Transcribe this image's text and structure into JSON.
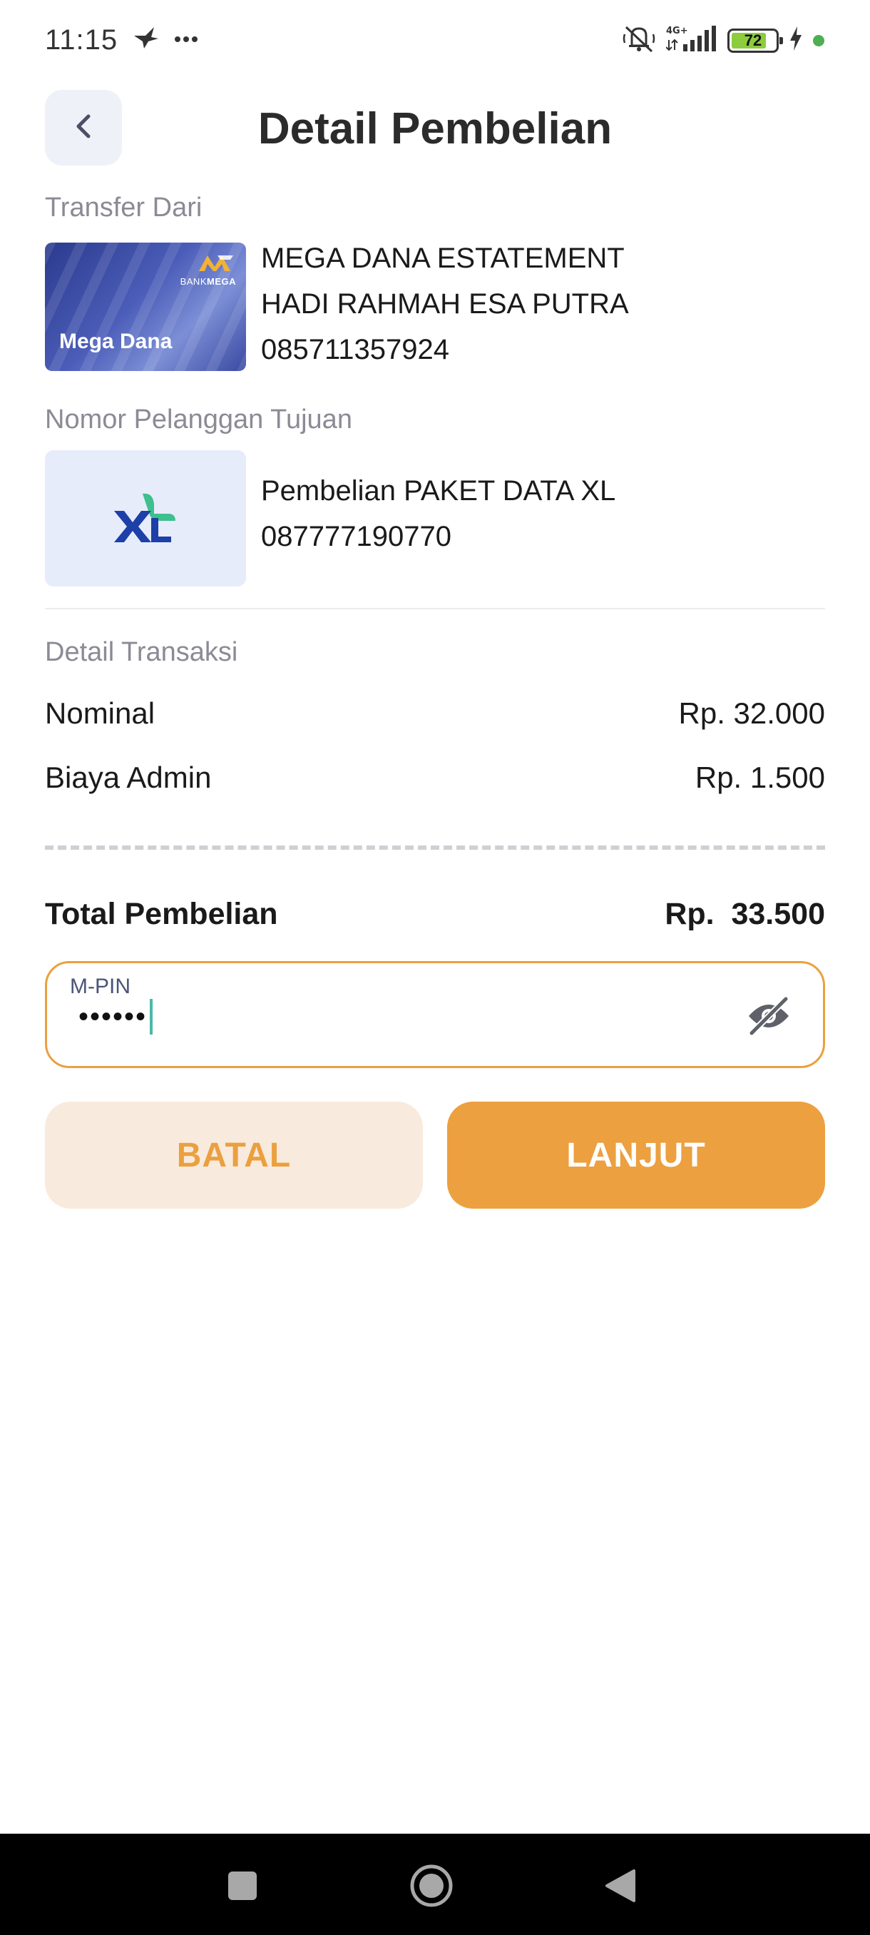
{
  "status_bar": {
    "time": "11:15",
    "battery_percent": "72",
    "network": "4G+",
    "icons": [
      "bird-icon",
      "more-dots-icon",
      "mute-icon",
      "signal-icon",
      "battery-icon",
      "charging-icon",
      "green-dot-icon"
    ]
  },
  "header": {
    "title": "Detail Pembelian",
    "back_icon": "chevron-left-icon"
  },
  "transfer_from": {
    "label": "Transfer Dari",
    "card": {
      "brand_small": "BANK",
      "brand_bold": "MEGA",
      "card_name": "Mega Dana"
    },
    "account_name": "MEGA DANA ESTATEMENT",
    "holder_name": "HADI RAHMAH ESA PUTRA",
    "phone": "085711357924"
  },
  "destination": {
    "label": "Nomor Pelanggan Tujuan",
    "logo": "xl-logo",
    "description": "Pembelian PAKET DATA XL",
    "number": "087777190770"
  },
  "transaction": {
    "label": "Detail Transaksi",
    "rows": [
      {
        "label": "Nominal",
        "value": "Rp. 32.000"
      },
      {
        "label": "Biaya Admin",
        "value": "Rp. 1.500"
      }
    ],
    "total_label": "Total Pembelian",
    "total_value": "Rp.  33.500"
  },
  "pin": {
    "label": "M-PIN",
    "masked_value": "••••••",
    "toggle_icon": "eye-off-icon"
  },
  "actions": {
    "cancel_label": "BATAL",
    "next_label": "LANJUT"
  },
  "colors": {
    "accent": "#eca03f",
    "cancel_bg": "#f8eadd",
    "back_bg": "#eff1f8",
    "xl_blue": "#1c3fa8",
    "xl_green": "#3ebf8f"
  },
  "nav_bar": {
    "icons": [
      "recent-apps-icon",
      "home-icon",
      "back-triangle-icon"
    ]
  }
}
